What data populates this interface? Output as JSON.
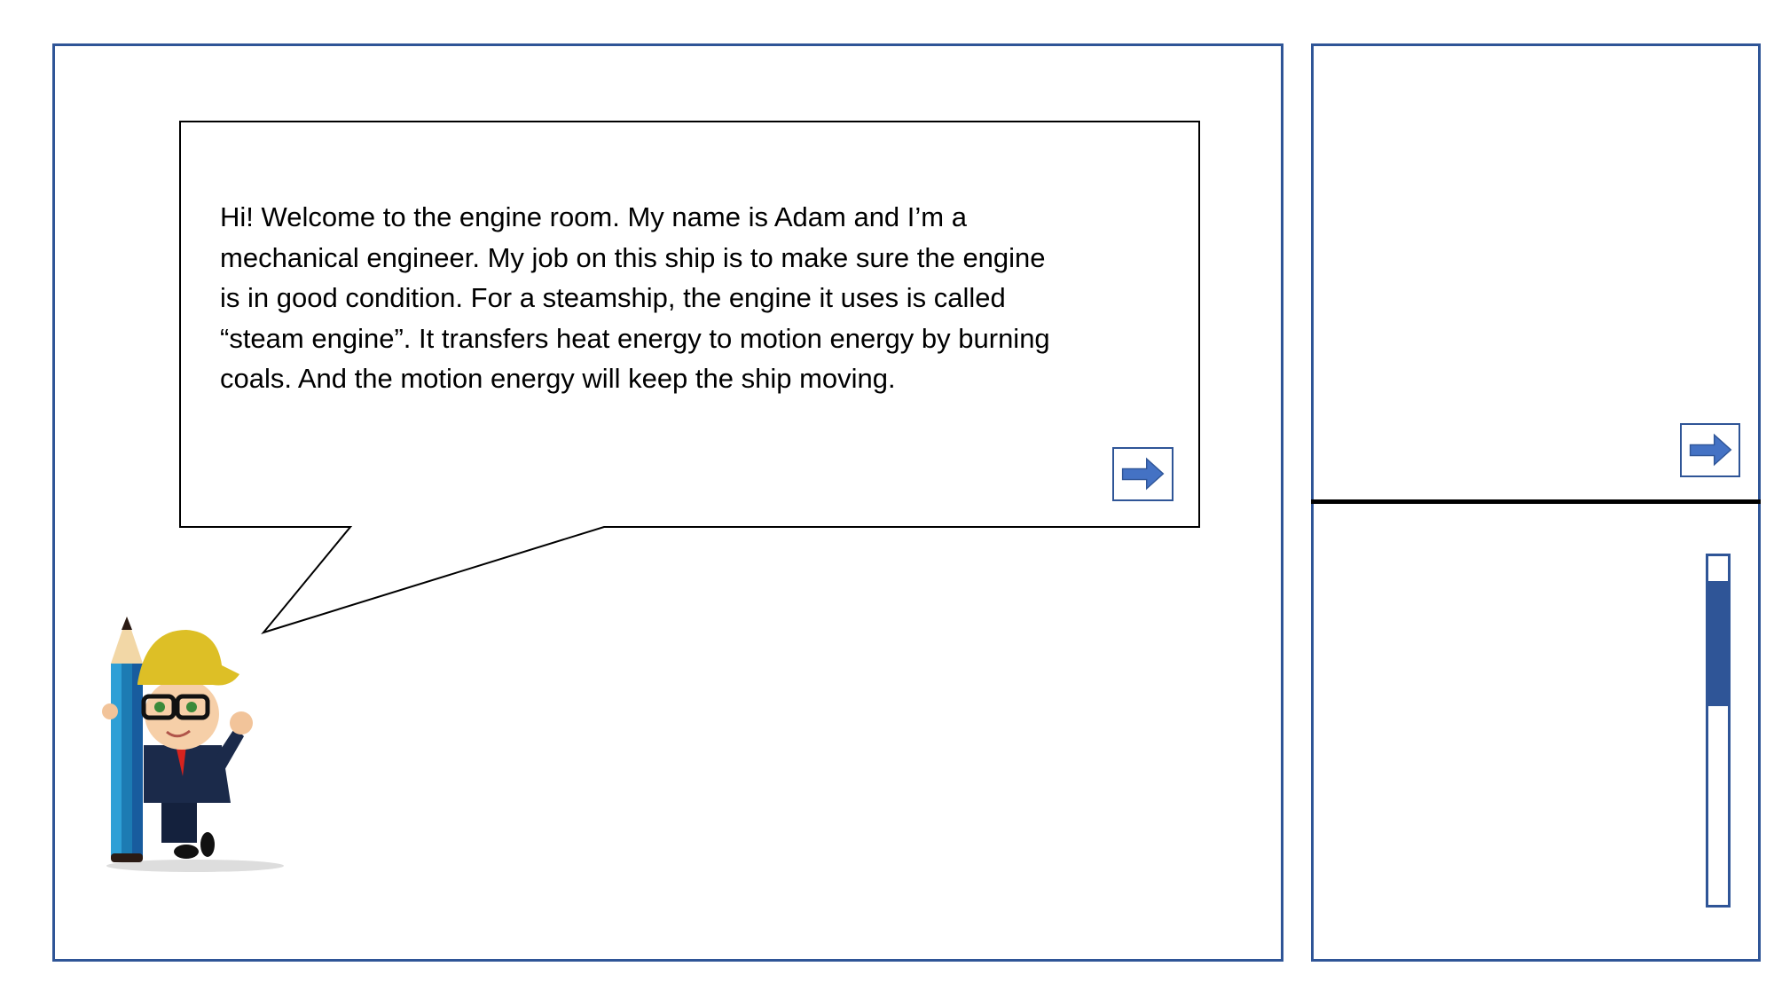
{
  "dialog": {
    "speaker": "Adam",
    "lines": [
      "Hi! Welcome to the engine room. My name is Adam and I’m a",
      "mechanical engineer. My job on this ship is to make sure the engine",
      "is in good condition. For a steamship, the engine it uses is called",
      "“steam engine”. It transfers heat energy to motion energy by burning",
      "coals. And the motion energy will keep the ship moving."
    ],
    "next_icon": "right-arrow-icon"
  },
  "side_panel": {
    "next_icon": "right-arrow-icon",
    "scrollbar": {
      "thumb_start_fraction": 0.07,
      "thumb_end_fraction": 0.43
    }
  },
  "colors": {
    "accent": "#2F5597",
    "arrow": "#4472C4"
  }
}
